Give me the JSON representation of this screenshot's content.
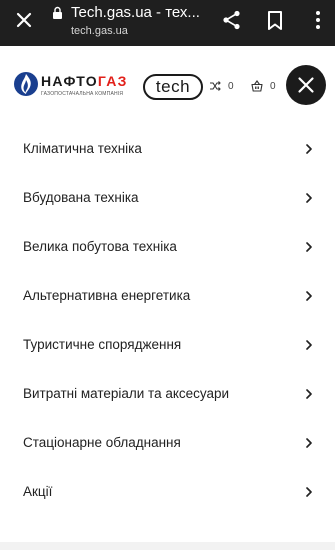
{
  "browser": {
    "title": "Tech.gas.ua - тех...",
    "url": "tech.gas.ua"
  },
  "header": {
    "logo_text_main": "НАФТО",
    "logo_text_accent": "ГАЗ",
    "logo_subtitle": "ГАЗОПОСТАЧАЛЬНА КОМПАНІЯ",
    "badge": "tech",
    "compare_count": "0",
    "cart_count": "0"
  },
  "menu": {
    "items": [
      {
        "label": "Кліматична техніка"
      },
      {
        "label": "Вбудована техніка"
      },
      {
        "label": "Велика побутова техніка"
      },
      {
        "label": "Альтернативна енергетика"
      },
      {
        "label": "Туристичне спорядження"
      },
      {
        "label": "Витратні матеріали та аксесуари"
      },
      {
        "label": "Стаціонарне обладнання"
      },
      {
        "label": "Акції"
      }
    ]
  },
  "colors": {
    "chrome_bg": "#1f1f1f",
    "brand_accent": "#e2201a",
    "close_button_bg": "#1b1b1b"
  }
}
